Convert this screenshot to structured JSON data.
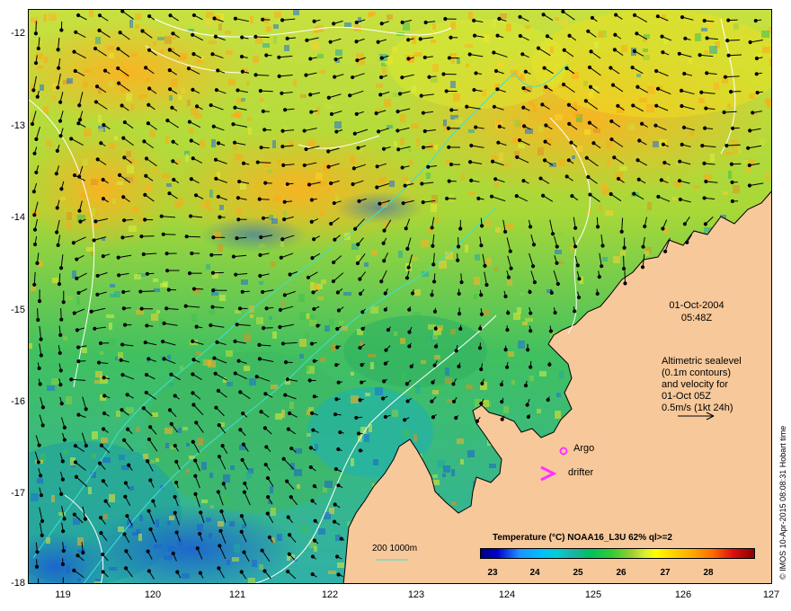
{
  "map": {
    "y_ticks": [
      "-12",
      "-13",
      "-14",
      "-15",
      "-16",
      "-17",
      "-18"
    ],
    "x_ticks": [
      "119",
      "120",
      "121",
      "122",
      "123",
      "124",
      "125",
      "126",
      "127"
    ]
  },
  "annotations": {
    "date": "01-Oct-2004",
    "time": "05:48Z",
    "altimetry_lines": [
      "Altimetric sealevel",
      "(0.1m contours)",
      "and velocity for",
      "01-Oct 05Z",
      "0.5m/s (1kt 24h)"
    ],
    "argo_label": "Argo",
    "drifter_label": "drifter",
    "isobath_label": "200  1000m"
  },
  "legend": {
    "title": "Temperature (°C) NOAA16_L3U 62% ql>=2",
    "ticks": [
      "23",
      "24",
      "25",
      "26",
      "27",
      "28"
    ]
  },
  "credit": "© IMOS 10-Apr-2015 08:08:31 Hobart time",
  "colors": {
    "land": "#f7c89a",
    "argo": "#ff33ff",
    "isobath": "#40e0d0"
  }
}
